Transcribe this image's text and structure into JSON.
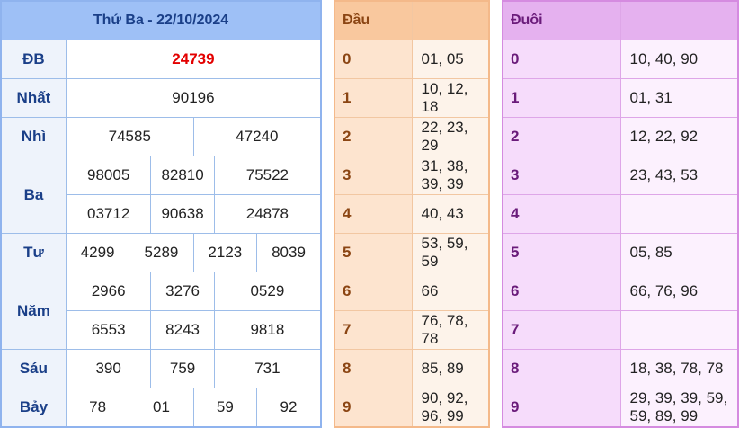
{
  "header": {
    "title": "Thứ Ba - 22/10/2024"
  },
  "prizes": {
    "db": {
      "label": "ĐB",
      "values": [
        "24739"
      ]
    },
    "nhat": {
      "label": "Nhất",
      "values": [
        "90196"
      ]
    },
    "nhi": {
      "label": "Nhì",
      "values": [
        "74585",
        "47240"
      ]
    },
    "ba": {
      "label": "Ba",
      "values": [
        "98005",
        "82810",
        "75522",
        "03712",
        "90638",
        "24878"
      ]
    },
    "tu": {
      "label": "Tư",
      "values": [
        "4299",
        "5289",
        "2123",
        "8039"
      ]
    },
    "nam": {
      "label": "Năm",
      "values": [
        "2966",
        "3276",
        "0529",
        "6553",
        "8243",
        "9818"
      ]
    },
    "sau": {
      "label": "Sáu",
      "values": [
        "390",
        "759",
        "731"
      ]
    },
    "bay": {
      "label": "Bảy",
      "values": [
        "78",
        "01",
        "59",
        "92"
      ]
    }
  },
  "dau": {
    "title": "Đầu",
    "rows": [
      {
        "digit": "0",
        "numbers": "01, 05"
      },
      {
        "digit": "1",
        "numbers": "10, 12, 18"
      },
      {
        "digit": "2",
        "numbers": "22, 23, 29"
      },
      {
        "digit": "3",
        "numbers": "31, 38, 39, 39"
      },
      {
        "digit": "4",
        "numbers": "40, 43"
      },
      {
        "digit": "5",
        "numbers": "53, 59, 59"
      },
      {
        "digit": "6",
        "numbers": "66"
      },
      {
        "digit": "7",
        "numbers": "76, 78, 78"
      },
      {
        "digit": "8",
        "numbers": "85, 89"
      },
      {
        "digit": "9",
        "numbers": "90, 92, 96, 99"
      }
    ]
  },
  "duoi": {
    "title": "Đuôi",
    "rows": [
      {
        "digit": "0",
        "numbers": "10, 40, 90"
      },
      {
        "digit": "1",
        "numbers": "01, 31"
      },
      {
        "digit": "2",
        "numbers": "12, 22, 92"
      },
      {
        "digit": "3",
        "numbers": "23, 43, 53"
      },
      {
        "digit": "4",
        "numbers": ""
      },
      {
        "digit": "5",
        "numbers": "05, 85"
      },
      {
        "digit": "6",
        "numbers": "66, 76, 96"
      },
      {
        "digit": "7",
        "numbers": ""
      },
      {
        "digit": "8",
        "numbers": "18, 38, 78, 78"
      },
      {
        "digit": "9",
        "numbers": "29, 39, 39, 59, 59, 89, 99"
      }
    ]
  },
  "colors": {
    "special_prize": "#e30000",
    "results_header": "#9ec0f6",
    "dau_header": "#f9c89e",
    "duoi_header": "#e5b1ef"
  }
}
